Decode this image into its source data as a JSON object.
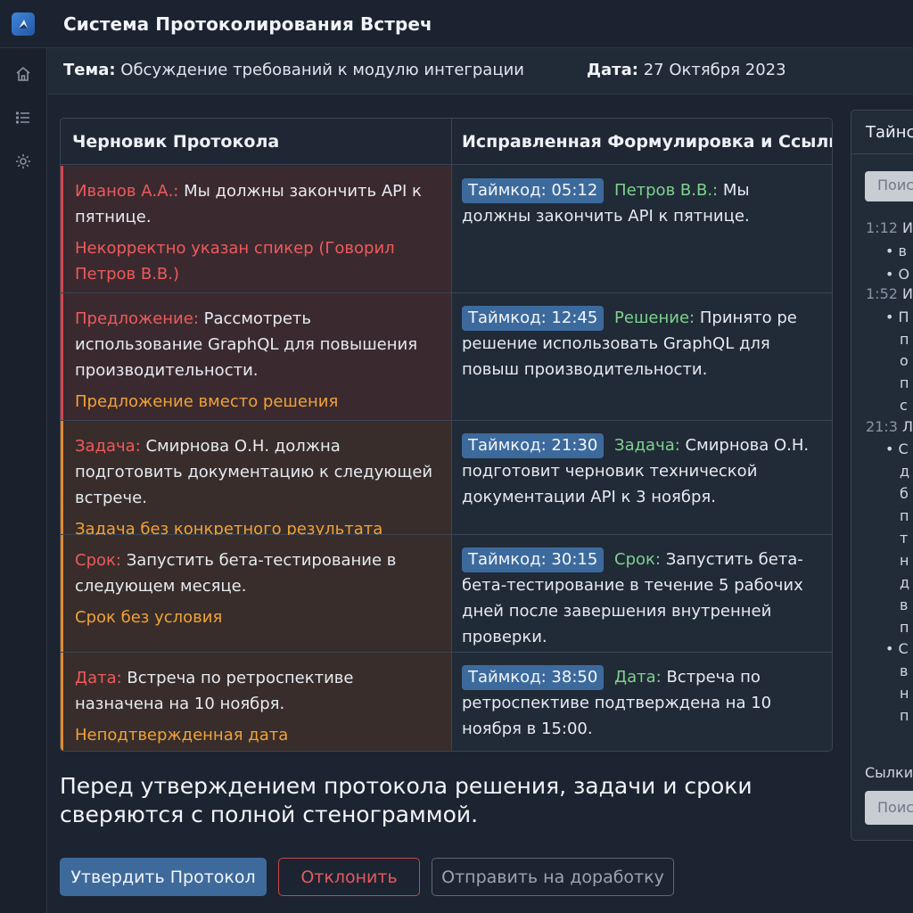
{
  "app": {
    "title": "Система Протоколирования Встреч"
  },
  "rail": {
    "icons": [
      "home-icon",
      "list-icon",
      "gear-icon"
    ]
  },
  "meeting": {
    "topic_label": "Тема:",
    "topic_value": "Обсуждение требований к модулю интеграции",
    "date_label": "Дата:",
    "date_value": "27 Октября 2023"
  },
  "table": {
    "headers": [
      "Черновик Протокола",
      "Исправленная Формулировка и Ссылки"
    ],
    "rows": [
      {
        "severity": "red",
        "draft_key": "Иванов А.А.:",
        "draft_text": "Мы должны закончить API к пятнице.",
        "issue": "Некорректно указан спикер (Говорил Петров В.В.)",
        "timecode": "Таймкод: 05:12",
        "fix_key": "Петров В.В.:",
        "fix_text": "Мы должны закончить API к пятнице."
      },
      {
        "severity": "red",
        "draft_key": "Предложение:",
        "draft_text": "Рассмотреть использование GraphQL для повышения производительности.",
        "issue": "Предложение вместо решения",
        "timecode": "Таймкод: 12:45",
        "fix_key": "Решение:",
        "fix_text": "Принято ре решение использовать GraphQL для повыш производительности."
      },
      {
        "severity": "orange",
        "draft_key": "Задача:",
        "draft_text": "Смирнова О.Н. должна подготовить документацию к следующей встрече.",
        "issue": "Задача без конкретного результата",
        "timecode": "Таймкод: 21:30",
        "fix_key": "Задача:",
        "fix_text": "Смирнова О.Н. подготовит черновик технической документации API к 3 ноября."
      },
      {
        "severity": "orange",
        "draft_key": "Срок:",
        "draft_text": "Запустить бета-тестирование в следующем месяце.",
        "issue": "Срок без условия",
        "timecode": "Таймкод: 30:15",
        "fix_key": "Срок:",
        "fix_text": "Запустить бета-бета-тестирование в течение 5 рабочих дней после завершения внутренней проверки."
      },
      {
        "severity": "orange",
        "draft_key": "Дата:",
        "draft_text": "Встреча по ретроспективе назначена на 10 ноября.",
        "issue": "Неподтвержденная дата",
        "timecode": "Таймкод: 38:50",
        "fix_key": "Дата:",
        "fix_text": "Встреча по ретроспективе подтверждена на 10 ноября в 15:00."
      }
    ]
  },
  "notice": "Перед утверждением протокола решения, задачи и сроки сверяются с полной стенограммой.",
  "actions": {
    "approve": "Утвердить Протокол",
    "reject": "Отклонить",
    "rework": "Отправить на доработку"
  },
  "transcript_panel": {
    "title": "Тайнс",
    "search_placeholder": "Поис",
    "lines": [
      {
        "ts": "1:12",
        "text": "И"
      },
      {
        "ts": "",
        "text": "• в"
      },
      {
        "ts": "",
        "text": "• О"
      },
      {
        "ts": "1:52",
        "text": "И"
      },
      {
        "ts": "",
        "text": "• П"
      },
      {
        "ts": "",
        "text": "п"
      },
      {
        "ts": "",
        "text": "о"
      },
      {
        "ts": "",
        "text": "п"
      },
      {
        "ts": "",
        "text": "с"
      },
      {
        "ts": "21:3",
        "text": "Л"
      },
      {
        "ts": "",
        "text": "• С"
      },
      {
        "ts": "",
        "text": "д"
      },
      {
        "ts": "",
        "text": "б"
      },
      {
        "ts": "",
        "text": "п"
      },
      {
        "ts": "",
        "text": "т"
      },
      {
        "ts": "",
        "text": "н"
      },
      {
        "ts": "",
        "text": "д"
      },
      {
        "ts": "",
        "text": "в"
      },
      {
        "ts": "",
        "text": "п"
      },
      {
        "ts": "",
        "text": "• С"
      },
      {
        "ts": "",
        "text": "в"
      },
      {
        "ts": "",
        "text": "н"
      },
      {
        "ts": "",
        "text": "п"
      }
    ],
    "links_label": "Сылки",
    "input_placeholder": "Поис"
  }
}
